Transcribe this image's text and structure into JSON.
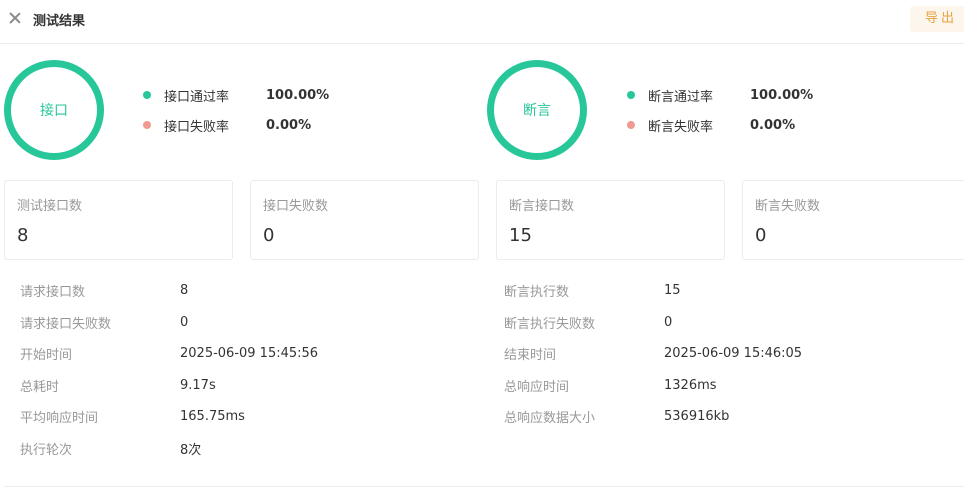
{
  "header": {
    "title": "测试结果",
    "export_label": "导出"
  },
  "api_summary": {
    "ring_label": "接口",
    "legend": [
      {
        "label": "接口通过率",
        "value": "100.00%",
        "color": "#27c79a"
      },
      {
        "label": "接口失败率",
        "value": "0.00%",
        "color": "#f19a8f"
      }
    ]
  },
  "assert_summary": {
    "ring_label": "断言",
    "legend": [
      {
        "label": "断言通过率",
        "value": "100.00%",
        "color": "#27c79a"
      },
      {
        "label": "断言失败率",
        "value": "0.00%",
        "color": "#f19a8f"
      }
    ]
  },
  "cards": [
    {
      "label": "测试接口数",
      "value": "8"
    },
    {
      "label": "接口失败数",
      "value": "0"
    },
    {
      "label": "断言接口数",
      "value": "15"
    },
    {
      "label": "断言失败数",
      "value": "0"
    }
  ],
  "details_left": [
    {
      "label": "请求接口数",
      "value": "8"
    },
    {
      "label": "请求接口失败数",
      "value": "0"
    },
    {
      "label": "开始时间",
      "value": "2025-06-09 15:45:56"
    },
    {
      "label": "总耗时",
      "value": "9.17s"
    },
    {
      "label": "平均响应时间",
      "value": "165.75ms"
    },
    {
      "label": "执行轮次",
      "value": "8次"
    }
  ],
  "details_right": [
    {
      "label": "断言执行数",
      "value": "15"
    },
    {
      "label": "断言执行失败数",
      "value": "0"
    },
    {
      "label": "结束时间",
      "value": "2025-06-09 15:46:05"
    },
    {
      "label": "总响应时间",
      "value": "1326ms"
    },
    {
      "label": "总响应数据大小",
      "value": "536916kb"
    }
  ],
  "colors": {
    "accent": "#27c79a",
    "fail": "#f19a8f",
    "export": "#e6a23c"
  }
}
